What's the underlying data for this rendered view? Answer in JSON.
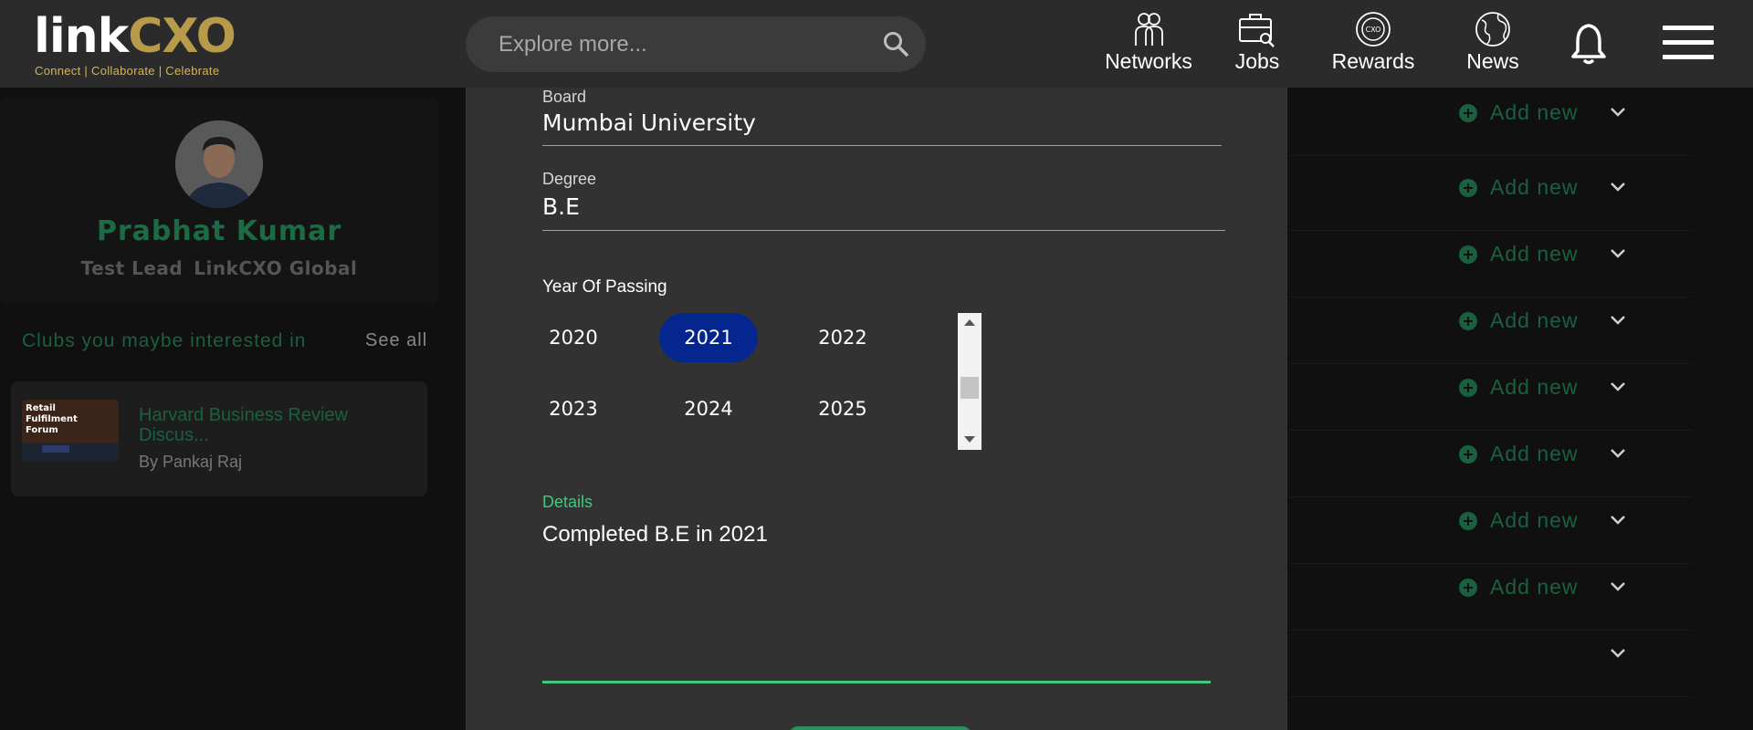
{
  "header": {
    "logo": {
      "word_part1": "link",
      "word_part2": "CXO",
      "tagline": "Connect | Collaborate | Celebrate"
    },
    "search": {
      "placeholder": "Explore more..."
    },
    "nav": [
      {
        "label": "Networks",
        "icon": "networks-icon"
      },
      {
        "label": "Jobs",
        "icon": "jobs-icon"
      },
      {
        "label": "Rewards",
        "icon": "rewards-icon"
      },
      {
        "label": "News",
        "icon": "news-icon"
      }
    ]
  },
  "sidebar": {
    "profile": {
      "name": "Prabhat Kumar",
      "title": "Test Lead",
      "company": "LinkCXO Global"
    },
    "clubs": {
      "heading": "Clubs you maybe interested in",
      "see_all": "See all",
      "items": [
        {
          "name": "Harvard Business Review Discus...",
          "author": "By Pankaj Raj",
          "thumb_text": "Retail Fulfilment Forum"
        }
      ]
    }
  },
  "education_form": {
    "board_label": "Board",
    "board_value": "Mumbai University",
    "degree_label": "Degree",
    "degree_value": "B.E",
    "year_label": "Year Of Passing",
    "years": [
      "2020",
      "2021",
      "2022",
      "2023",
      "2024",
      "2025"
    ],
    "selected_year": "2021",
    "details_label": "Details",
    "details_value": "Completed B.E in 2021"
  },
  "right_panel": {
    "add_label": "Add new",
    "rows": 9
  },
  "colors": {
    "accent_green": "#1a6040",
    "active_green": "#3ec97e",
    "selected_blue": "#05268f",
    "logo_gold": "#b79a4a"
  }
}
